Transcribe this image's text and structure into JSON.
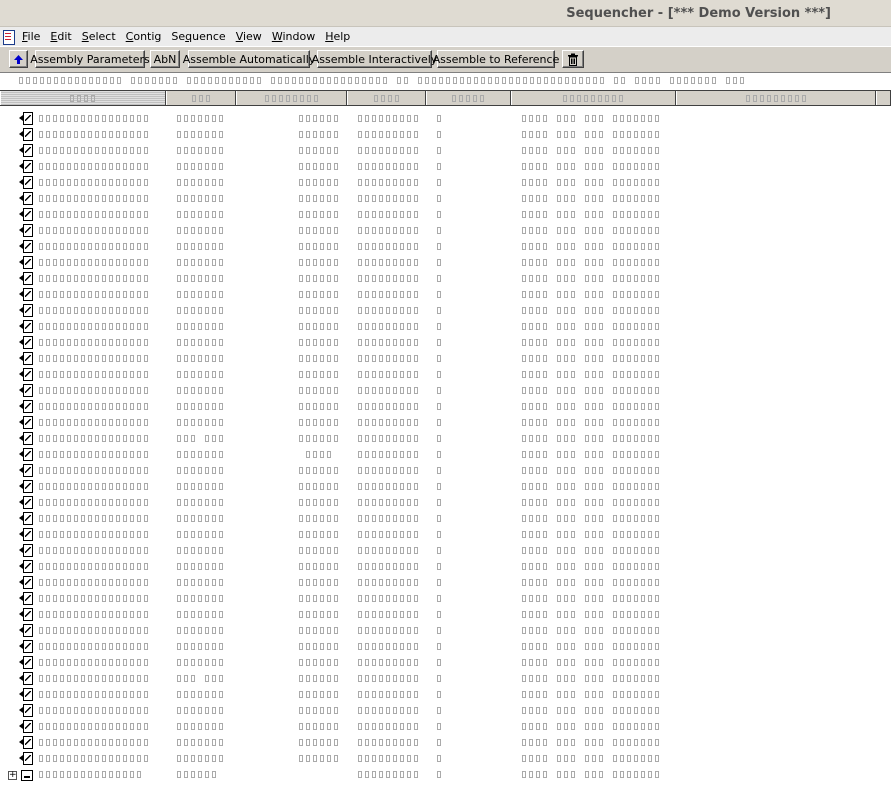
{
  "window": {
    "title": "Sequencher - [*** Demo Version ***]"
  },
  "menu": [
    {
      "key": "file",
      "underline": "F",
      "rest": "ile"
    },
    {
      "key": "edit",
      "underline": "E",
      "rest": "dit"
    },
    {
      "key": "select",
      "underline": "S",
      "rest": "elect"
    },
    {
      "key": "contig",
      "underline": "C",
      "rest": "ontig"
    },
    {
      "key": "sequence",
      "prefix": "Se",
      "underline": "q",
      "rest": "uence"
    },
    {
      "key": "view",
      "underline": "V",
      "rest": "iew"
    },
    {
      "key": "window",
      "underline": "W",
      "rest": "indow"
    },
    {
      "key": "help",
      "underline": "H",
      "rest": "elp"
    }
  ],
  "toolbar": {
    "assembly_parameters": "Assembly Parameters",
    "abn": "AbN",
    "assemble_automatically": "Assemble Automatically",
    "assemble_interactively": "Assemble Interactively",
    "assemble_to_reference": "Assemble to Reference"
  },
  "icons": {
    "up": "up-arrow-icon",
    "trash": "trash-icon",
    "sequence": "sequence-file-icon",
    "contig": "contig-icon"
  },
  "colors": {
    "toolbar_bg": "#d4d0c8",
    "title_bg": "#dfdbd2",
    "up_arrow": "#0000cc"
  }
}
